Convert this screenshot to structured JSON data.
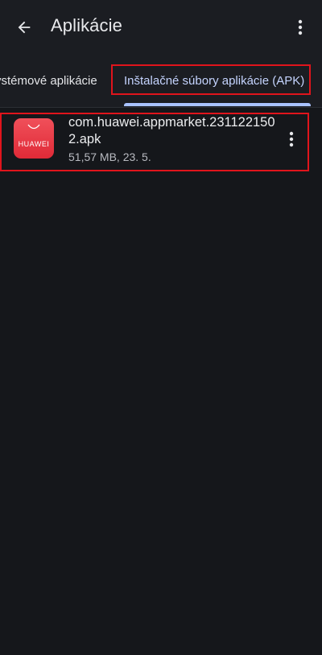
{
  "header": {
    "title": "Aplikácie",
    "back_icon": "arrow-left-icon",
    "menu_icon": "more-vert-icon"
  },
  "tabs": [
    {
      "label": "Systémové aplikácie",
      "visible_label": "ystémové aplikácie",
      "selected": false
    },
    {
      "label": "Inštalačné súbory aplikácie (APK)",
      "selected": true
    }
  ],
  "files": [
    {
      "name": "com.huawei.appmarket.2311221502.apk",
      "meta": "51,57 MB, 23. 5.",
      "icon_label": "HUAWEI",
      "icon_color": "#e8343f",
      "menu_icon": "more-vert-icon"
    }
  ],
  "colors": {
    "background": "#15171b",
    "tab_accent": "#a9c2ff",
    "highlight_border": "#e0141c"
  }
}
